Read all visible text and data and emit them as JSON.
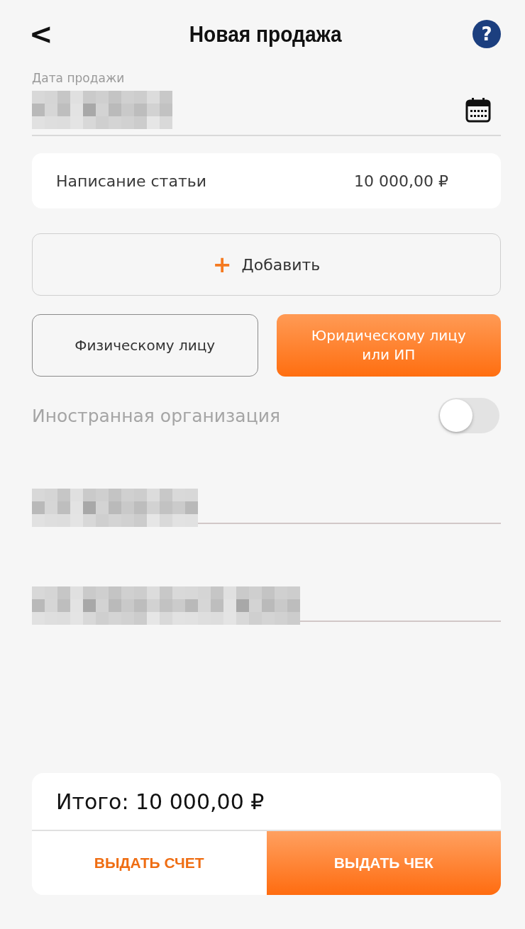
{
  "header": {
    "title": "Новая продажа",
    "back": "<",
    "help": "?"
  },
  "date_field": {
    "label": "Дата продажи",
    "kind": "redacted"
  },
  "items": [
    {
      "name": "Написание статьи",
      "price": "10 000,00 ₽"
    }
  ],
  "add_button": {
    "icon": "+",
    "label": "Добавить"
  },
  "client_types": [
    {
      "label": "Физическому лицу",
      "selected": false
    },
    {
      "label": "Юридическому лицу или ИП",
      "selected": true
    }
  ],
  "foreign_toggle": {
    "label": "Иностранная организация",
    "on": false
  },
  "fields": [
    {
      "kind": "redacted"
    },
    {
      "kind": "redacted"
    }
  ],
  "footer": {
    "total": "Итого: 10 000,00 ₽",
    "buttons": [
      {
        "label": "ВЫДАТЬ СЧЕТ",
        "kind": "secondary"
      },
      {
        "label": "ВЫДАТЬ ЧЕК",
        "kind": "primary"
      }
    ]
  }
}
